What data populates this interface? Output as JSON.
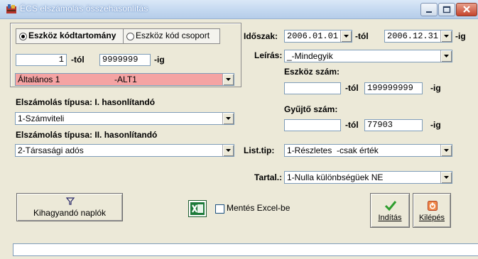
{
  "window": {
    "title": "ÉCS elszámolás összehasonlítás",
    "controls": {
      "minimize": "minimize-icon",
      "maximize": "maximize-icon",
      "close": "close-icon"
    }
  },
  "range": {
    "radio_range_label": "Eszköz kódtartomány",
    "radio_group_label": "Eszköz kód csoport",
    "selected": "range",
    "from_value": "1",
    "from_suffix": "-tól",
    "to_value": "9999999",
    "to_suffix": "-ig",
    "category_value": "Általános 1                       -ALT1"
  },
  "accounting": {
    "type1_label": "Elszámolás típusa: I. hasonlítandó",
    "type1_value": "1-Számviteli",
    "type2_label": "Elszámolás típusa: II. hasonlítandó",
    "type2_value": "2-Társasági adós"
  },
  "period": {
    "label": "Időszak:",
    "from": "2006.01.01",
    "from_suffix": "-tól",
    "to": "2006.12.31",
    "to_suffix": "-ig"
  },
  "description": {
    "label": "Leírás:",
    "value": "_-Mindegyik"
  },
  "asset_number": {
    "label": "Eszköz szám:",
    "from": "",
    "from_suffix": "-tól",
    "to": "199999999",
    "to_suffix": "-ig"
  },
  "collector_number": {
    "label": "Gyűjtő szám:",
    "from": "",
    "from_suffix": "-tól",
    "to": "77903",
    "to_suffix": "-ig"
  },
  "list_type": {
    "label": "List.tip:",
    "value": "1-Részletes  -csak érték"
  },
  "content": {
    "label": "Tartal.:",
    "value": "1-Nulla különbségüek NE"
  },
  "buttons": {
    "skip_journals": "Kihagyandó naplók",
    "excel_save": "Mentés Excel-be",
    "excel_checked": false,
    "start": "Indítás",
    "exit": "Kilépés"
  },
  "status_bar": "",
  "colors": {
    "highlight_pink": "#f4a3a3",
    "excel_green": "#1d7a3a",
    "start_check": "#2e9e2e",
    "exit_red": "#d9472b"
  }
}
